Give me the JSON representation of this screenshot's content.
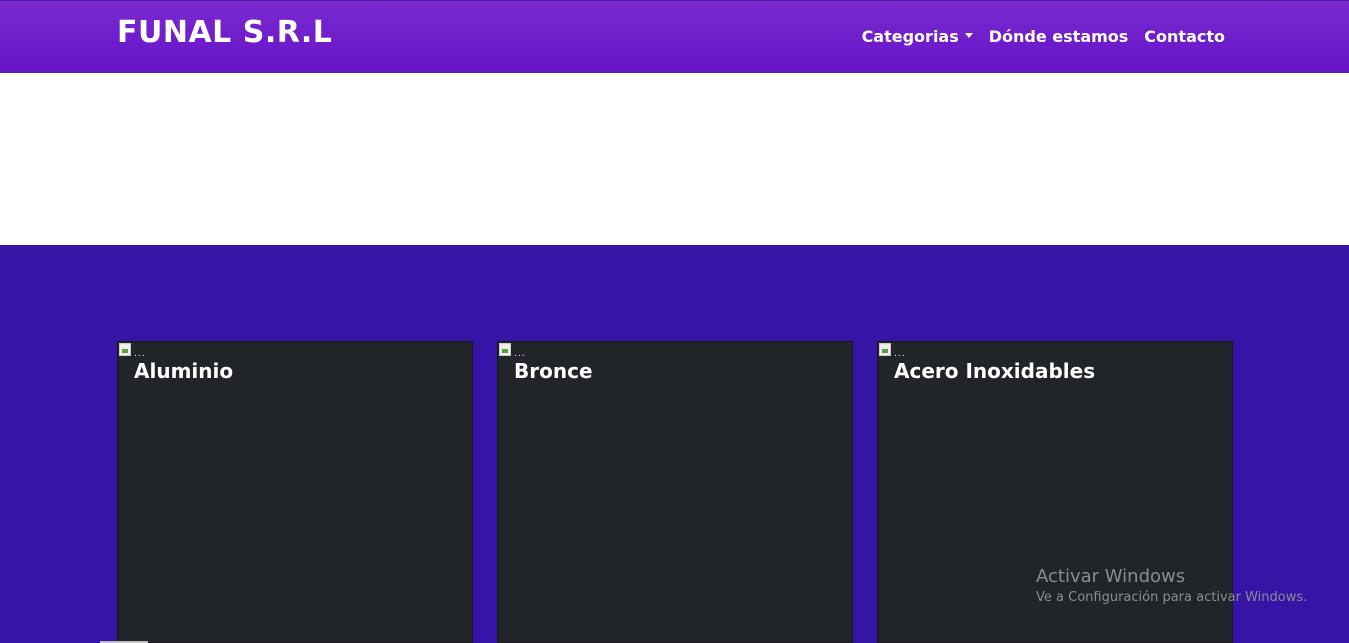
{
  "brand": {
    "title": "FUNAL S.R.L"
  },
  "nav": {
    "items": [
      {
        "label": "Categorias",
        "has_dropdown": true
      },
      {
        "label": "Dónde estamos"
      },
      {
        "label": "Contacto"
      }
    ]
  },
  "cards": [
    {
      "title": "Aluminio",
      "image_alt": "..."
    },
    {
      "title": "Bronce",
      "image_alt": "..."
    },
    {
      "title": "Acero Inoxidables",
      "image_alt": "..."
    }
  ],
  "watermark": {
    "title": "Activar Windows",
    "subtitle": "Ve a Configuración para activar Windows."
  },
  "colors": {
    "navbar": "#6a17c9",
    "section": "#3514a6",
    "card": "#212529"
  },
  "icons": {
    "dropdown": "caret-down-icon",
    "broken_image": "broken-image-icon"
  }
}
